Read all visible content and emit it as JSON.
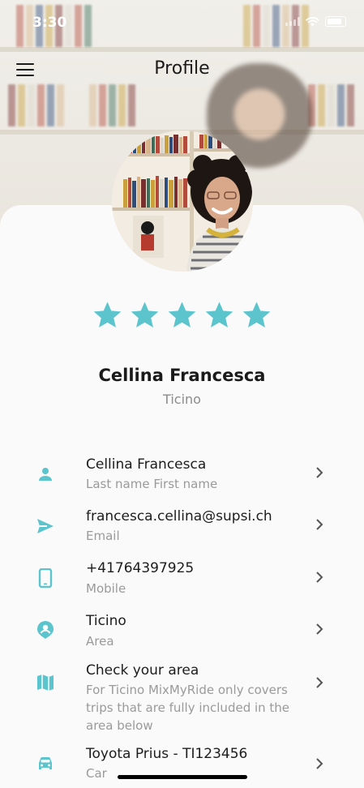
{
  "status_bar": {
    "time": "3:30"
  },
  "header": {
    "title": "Profile"
  },
  "profile": {
    "name": "Cellina Francesca",
    "region": "Ticino",
    "rating": 5,
    "rating_max": 5
  },
  "colors": {
    "accent": "#5bc4cd",
    "text": "#1d1d1d",
    "secondary_text": "#9a9a9a"
  },
  "details": [
    {
      "icon": "person-icon",
      "value": "Cellina Francesca",
      "label": "Last name First name"
    },
    {
      "icon": "send-icon",
      "value": "francesca.cellina@supsi.ch",
      "label": "Email"
    },
    {
      "icon": "mobile-phone-icon",
      "value": "+41764397925",
      "label": "Mobile"
    },
    {
      "icon": "location-person-icon",
      "value": "Ticino",
      "label": "Area"
    },
    {
      "icon": "map-icon",
      "value": "Check your area",
      "label": "For Ticino MixMyRide only covers trips that are fully included in the area below"
    },
    {
      "icon": "car-icon",
      "value": "Toyota Prius - TI123456",
      "label": "Car"
    }
  ]
}
